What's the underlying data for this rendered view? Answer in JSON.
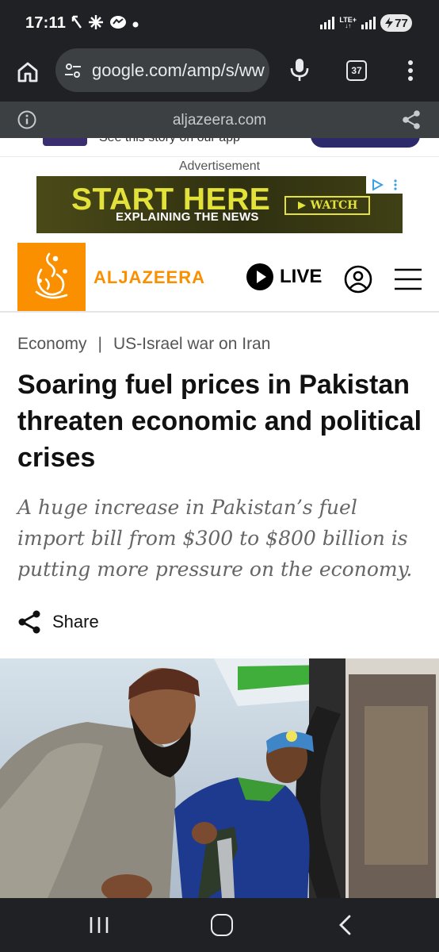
{
  "status_bar": {
    "time": "17:11",
    "network": "LTE+",
    "battery": "77"
  },
  "browser": {
    "url": "google.com/amp/s/www.aljazeera.com",
    "tab_count": "37"
  },
  "amp_bar": {
    "domain": "aljazeera.com"
  },
  "promo_banner": {
    "text": "See this story on our app"
  },
  "ad": {
    "label": "Advertisement",
    "title": "START HERE",
    "subtitle": "EXPLAINING THE NEWS",
    "cta": "WATCH"
  },
  "site_header": {
    "brand": "ALJAZEERA",
    "live_label": "LIVE"
  },
  "article": {
    "breadcrumb": [
      "Economy",
      "US-Israel war on Iran"
    ],
    "breadcrumb_separator": "|",
    "headline": "Soaring fuel prices in Pakistan threaten economic and political crises",
    "subhead": "A huge increase in Pakistan’s fuel import bill from $300 to $800 billion is putting more pressure on the economy.",
    "share_label": "Share"
  },
  "colors": {
    "brand_orange": "#fa9000",
    "chrome_dark": "#202124",
    "ad_yellow": "#e3e23b"
  }
}
